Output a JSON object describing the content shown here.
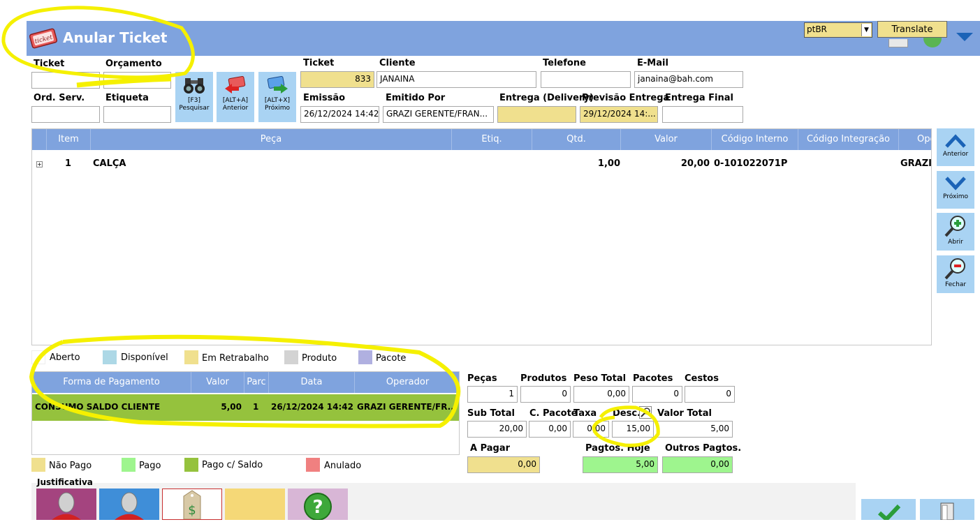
{
  "header": {
    "title": "Anular Ticket",
    "language": "ptBR",
    "translate_label": "Translate"
  },
  "search": {
    "ticket_label": "Ticket",
    "ticket_value": "",
    "orcamento_label": "Orçamento",
    "orcamento_value": "",
    "ordserv_label": "Ord. Serv.",
    "ordserv_value": "",
    "etiqueta_label": "Etiqueta",
    "etiqueta_value": ""
  },
  "toolbar": {
    "pesquisar": [
      "[F3]",
      "Pesquisar"
    ],
    "anterior": [
      "[ALT+A]",
      "Anterior"
    ],
    "proximo": [
      "[ALT+X]",
      "Próximo"
    ]
  },
  "info": {
    "ticket_label": "Ticket",
    "ticket_value": "833",
    "cliente_label": "Cliente",
    "cliente_value": "JANAINA",
    "telefone_label": "Telefone",
    "telefone_value": "",
    "email_label": "E-Mail",
    "email_value": "janaina@bah.com",
    "emissao_label": "Emissão",
    "emissao_value": "26/12/2024 14:42",
    "emitido_label": "Emitido Por",
    "emitido_value": "GRAZI GERENTE/FRAN...",
    "entrega_label": "Entrega (Delivery)",
    "entrega_value": "",
    "previsao_label": "Previsão Entrega",
    "previsao_value": "29/12/2024 14:...",
    "final_label": "Entrega Final",
    "final_value": ""
  },
  "grid": {
    "columns": [
      "Item",
      "Peça",
      "Etiq.",
      "Qtd.",
      "Valor",
      "Código Interno",
      "Código Integração",
      "Ope"
    ],
    "rows": [
      {
        "expand": "+",
        "item": "1",
        "peca": "CALÇA",
        "etiq": "",
        "qtd": "1,00",
        "valor": "20,00",
        "codigo": "0-101022071P",
        "integracao": "",
        "operador": "GRAZI"
      }
    ]
  },
  "side": {
    "anterior": "Anterior",
    "proximo": "Próximo",
    "abrir": "Abrir",
    "fechar": "Fechar"
  },
  "legend_items": [
    {
      "label": "Aberto",
      "color": "#ffffff"
    },
    {
      "label": "Disponível",
      "color": "#add8e6"
    },
    {
      "label": "Em Retrabalho",
      "color": "#f0e08e"
    },
    {
      "label": "Produto",
      "color": "#d3d3d3"
    },
    {
      "label": "Pacote",
      "color": "#b0b0e0"
    }
  ],
  "payments": {
    "columns": [
      "Forma de Pagamento",
      "Valor",
      "Parc",
      "Data",
      "Operador"
    ],
    "rows": [
      {
        "forma": "CONSUMO SALDO CLIENTE",
        "valor": "5,00",
        "parc": "1",
        "data": "26/12/2024 14:42",
        "operador": "GRAZI  GERENTE/FR..."
      }
    ]
  },
  "pay_legend": [
    {
      "label": "Não Pago",
      "color": "#f0e08e"
    },
    {
      "label": "Pago",
      "color": "#9ef58e"
    },
    {
      "label": "Pago c/ Saldo",
      "color": "#95c23d"
    },
    {
      "label": "Anulado",
      "color": "#f08080"
    }
  ],
  "totals": {
    "pecas_label": "Peças",
    "pecas": "1",
    "produtos_label": "Produtos",
    "produtos": "0",
    "peso_label": "Peso Total",
    "peso": "0,00",
    "pacotes_label": "Pacotes",
    "pacotes": "0",
    "cestos_label": "Cestos",
    "cestos": "0",
    "subtotal_label": "Sub Total",
    "subtotal": "20,00",
    "cpacote_label": "C. Pacote",
    "cpacote": "0,00",
    "taxa_label": "Taxa",
    "taxa": "0,00",
    "desc_label": "Desc.",
    "desc": "15,00",
    "valortotal_label": "Valor Total",
    "valortotal": "5,00",
    "apagar_label": "A Pagar",
    "apagar": "0,00",
    "pagtoshoje_label": "Pagtos. Hoje",
    "pagtoshoje": "5,00",
    "outros_label": "Outros Pagtos.",
    "outros": "0,00"
  },
  "justificativa": {
    "label": "Justificativa"
  },
  "colors": {
    "header_blue": "#7fa3de",
    "button_blue": "#a9d3f3",
    "highlight_yellow": "#f5f000"
  }
}
